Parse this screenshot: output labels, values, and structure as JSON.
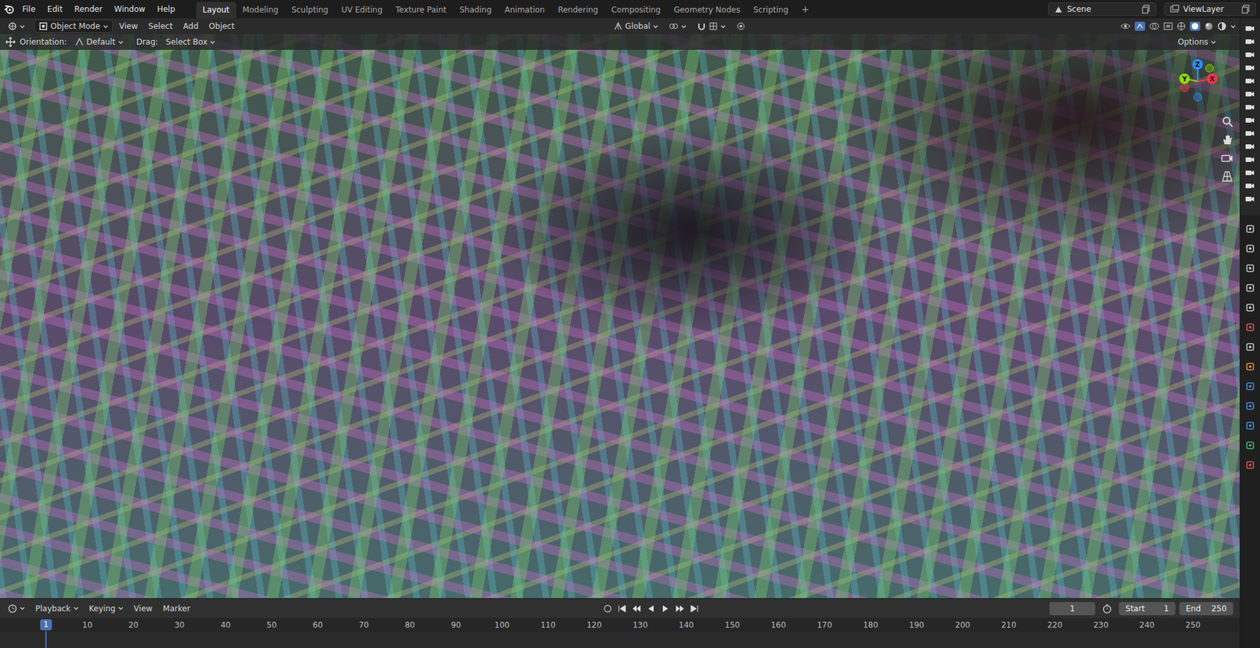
{
  "topbar": {
    "menus": [
      "File",
      "Edit",
      "Render",
      "Window",
      "Help"
    ],
    "workspaces": [
      {
        "label": "Layout",
        "selected": true
      },
      {
        "label": "Modeling",
        "selected": false
      },
      {
        "label": "Sculpting",
        "selected": false
      },
      {
        "label": "UV Editing",
        "selected": false
      },
      {
        "label": "Texture Paint",
        "selected": false
      },
      {
        "label": "Shading",
        "selected": false
      },
      {
        "label": "Animation",
        "selected": false
      },
      {
        "label": "Rendering",
        "selected": false
      },
      {
        "label": "Compositing",
        "selected": false
      },
      {
        "label": "Geometry Nodes",
        "selected": false
      },
      {
        "label": "Scripting",
        "selected": false
      }
    ],
    "add_workspace": "+",
    "scene": "Scene",
    "view_layer": "ViewLayer"
  },
  "header": {
    "mode": "Object Mode",
    "menus": [
      "View",
      "Select",
      "Add",
      "Object"
    ],
    "transform_orientation": "Global"
  },
  "tool_settings": {
    "orientation_label": "Orientation:",
    "orientation": "Default",
    "drag_label": "Drag:",
    "drag": "Select Box",
    "options": "Options"
  },
  "viewport": {
    "gizmo": [
      {
        "label": "Z",
        "color": "#2c8fff"
      },
      {
        "label": "X",
        "color": "#ff3352"
      },
      {
        "label": "Y",
        "color": "#8bdc00"
      }
    ]
  },
  "timeline": {
    "menus": [
      "Playback",
      "Keying",
      "View",
      "Marker"
    ],
    "current_frame": "1",
    "start_label": "Start",
    "start": "1",
    "end_label": "End",
    "end": "250",
    "playhead": "1",
    "ticks": [
      "10",
      "20",
      "30",
      "40",
      "50",
      "60",
      "70",
      "80",
      "90",
      "100",
      "110",
      "120",
      "130",
      "140",
      "150",
      "160",
      "170",
      "180",
      "190",
      "200",
      "210",
      "220",
      "230",
      "240",
      "250"
    ]
  },
  "outliner": {
    "rows": [
      {
        "render_enabled": true
      },
      {
        "render_enabled": true
      },
      {
        "render_enabled": true
      },
      {
        "render_enabled": true
      },
      {
        "render_enabled": true
      },
      {
        "render_enabled": true
      },
      {
        "render_enabled": true
      },
      {
        "render_enabled": true
      },
      {
        "render_enabled": true
      },
      {
        "render_enabled": true
      },
      {
        "render_enabled": true
      },
      {
        "render_enabled": true
      },
      {
        "render_enabled": true
      },
      {
        "render_enabled": true
      }
    ]
  },
  "properties": {
    "tabs": [
      {
        "color": "#c8c8c8"
      },
      {
        "color": "#c8c8c8"
      },
      {
        "color": "#c8c8c8"
      },
      {
        "color": "#c8c8c8"
      },
      {
        "color": "#c8c8c8"
      },
      {
        "color": "#e05555"
      },
      {
        "color": "#c8c8c8"
      },
      {
        "color": "#e8913a"
      },
      {
        "color": "#4a8fe8"
      },
      {
        "color": "#4a8fe8"
      },
      {
        "color": "#4a8fe8"
      },
      {
        "color": "#3fbf6f"
      },
      {
        "color": "#e05555"
      }
    ]
  }
}
